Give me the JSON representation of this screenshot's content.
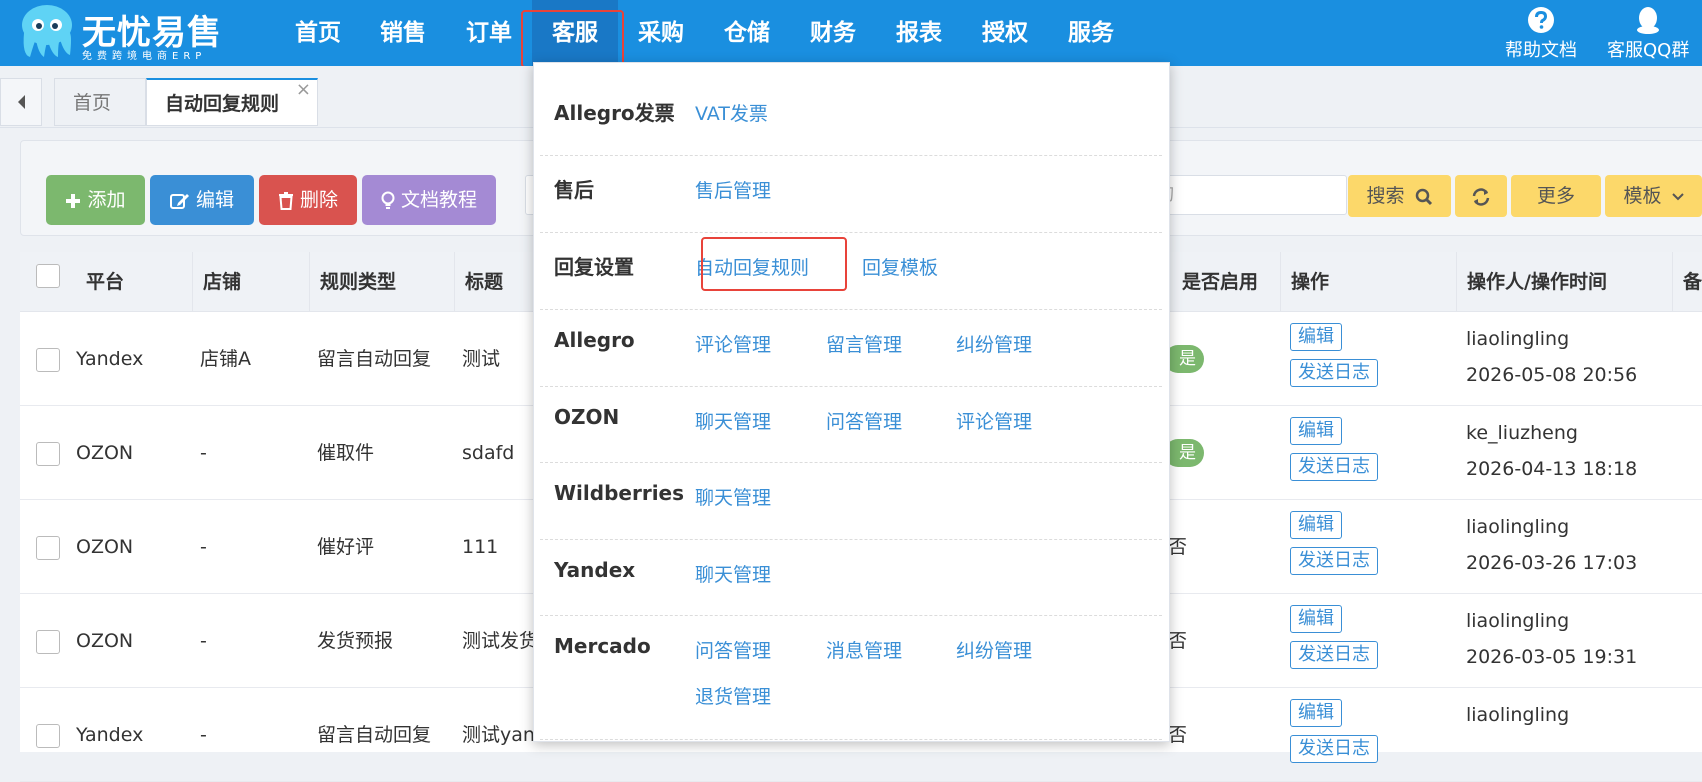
{
  "logo": {
    "title": "无忧易售",
    "subtitle": "免费跨境电商ERP"
  },
  "nav": [
    "首页",
    "销售",
    "订单",
    "客服",
    "采购",
    "仓储",
    "财务",
    "报表",
    "授权",
    "服务"
  ],
  "header_right": {
    "help": "帮助文档",
    "qq": "客服QQ群"
  },
  "tabs": {
    "home": "首页",
    "current": "自动回复规则",
    "close": "×"
  },
  "toolbar": {
    "add": "添加",
    "edit": "编辑",
    "delete": "删除",
    "docs": "文档教程",
    "search_placeholder": "询",
    "search": "搜索",
    "more": "更多",
    "template": "模板"
  },
  "table": {
    "headers": [
      "平台",
      "店铺",
      "规则类型",
      "标题",
      "是否启用",
      "操作",
      "操作人/操作时间",
      "备注"
    ],
    "op_edit": "编辑",
    "op_log": "发送日志",
    "rows": [
      {
        "platform": "Yandex",
        "store": "店铺A",
        "type": "留言自动回复",
        "title": "测试",
        "enabled": "是",
        "user": "liaolingling",
        "time": "2026-05-08 20:56"
      },
      {
        "platform": "OZON",
        "store": "-",
        "type": "催取件",
        "title": "sdafd",
        "enabled": "是",
        "user": "ke_liuzheng",
        "time": "2026-04-13 18:18"
      },
      {
        "platform": "OZON",
        "store": "-",
        "type": "催好评",
        "title": "111",
        "enabled": "否",
        "user": "liaolingling",
        "time": "2026-03-26 17:03"
      },
      {
        "platform": "OZON",
        "store": "-",
        "type": "发货预报",
        "title": "测试发货",
        "enabled": "否",
        "user": "liaolingling",
        "time": "2026-03-05 19:31"
      },
      {
        "platform": "Yandex",
        "store": "-",
        "type": "留言自动回复",
        "title": "测试yandex",
        "enabled": "否",
        "user": "liaolingling",
        "time": ""
      }
    ]
  },
  "dropdown": [
    {
      "label": "Allegro发票",
      "links": [
        "VAT发票"
      ]
    },
    {
      "label": "售后",
      "links": [
        "售后管理"
      ]
    },
    {
      "label": "回复设置",
      "links": [
        "自动回复规则",
        "回复模板"
      ]
    },
    {
      "label": "Allegro",
      "links": [
        "评论管理",
        "留言管理",
        "纠纷管理"
      ]
    },
    {
      "label": "OZON",
      "links": [
        "聊天管理",
        "问答管理",
        "评论管理"
      ]
    },
    {
      "label": "Wildberries",
      "links": [
        "聊天管理"
      ]
    },
    {
      "label": "Yandex",
      "links": [
        "聊天管理"
      ]
    },
    {
      "label": "Mercado",
      "links": [
        "问答管理",
        "消息管理",
        "纠纷管理",
        "退货管理"
      ]
    }
  ],
  "colors": {
    "topbar": "#1a8fe0",
    "active_nav": "#1978c6",
    "highlight": "#e8433a",
    "add": "#7cb86e",
    "edit": "#3a8fd6",
    "delete": "#d9534f",
    "docs": "#a48ad4",
    "yellow": "#fcd86a",
    "link": "#3a8fd6"
  }
}
